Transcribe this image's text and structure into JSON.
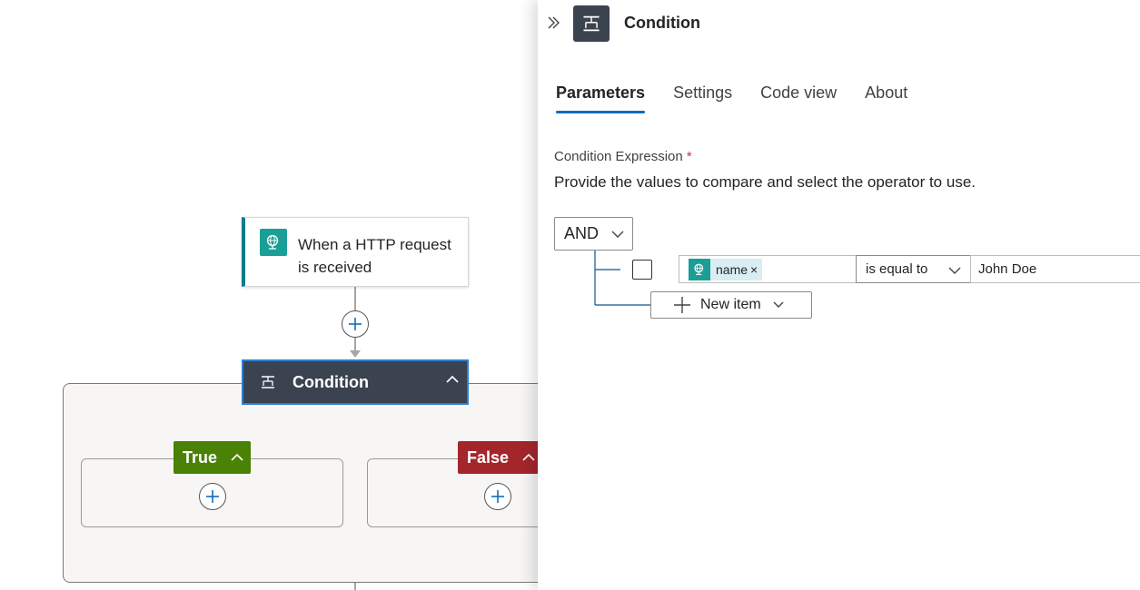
{
  "canvas": {
    "trigger": {
      "title": "When a HTTP request is received",
      "icon": "http-request-icon"
    },
    "condition_node": {
      "label": "Condition",
      "icon": "condition-icon"
    },
    "branches": [
      {
        "label": "True",
        "color": "#498205"
      },
      {
        "label": "False",
        "color": "#a4262c"
      }
    ]
  },
  "panel": {
    "title": "Condition",
    "tabs": [
      {
        "label": "Parameters",
        "active": true
      },
      {
        "label": "Settings",
        "active": false
      },
      {
        "label": "Code view",
        "active": false
      },
      {
        "label": "About",
        "active": false
      }
    ],
    "field_label": "Condition Expression",
    "required_mark": "*",
    "description": "Provide the values to compare and select the operator to use.",
    "group_operator": "AND",
    "row": {
      "checked": false,
      "token_label": "name",
      "token_remove": "×",
      "operator": "is equal to",
      "value": "John Doe"
    },
    "new_item_label": "New item"
  },
  "colors": {
    "accent": "#0f6cbd",
    "node_dark": "#3b4350",
    "trigger_teal": "#1b9e96"
  }
}
